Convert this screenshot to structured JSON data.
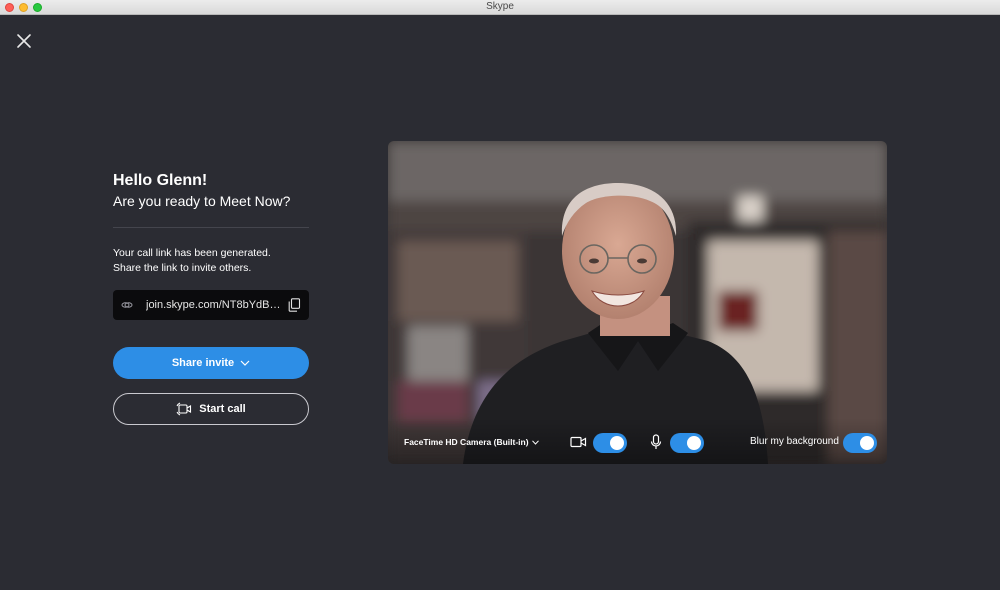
{
  "window": {
    "title": "Skype"
  },
  "greeting": {
    "title": "Hello Glenn!",
    "subtitle": "Are you ready to Meet Now?"
  },
  "link": {
    "info_line1": "Your call link has been generated.",
    "info_line2": "Share the link to invite others.",
    "url": "join.skype.com/NT8bYdBDn..."
  },
  "buttons": {
    "share_invite": "Share invite",
    "start_call": "Start call"
  },
  "preview": {
    "camera_name": "FaceTime HD Camera (Built-in)",
    "video_enabled": true,
    "mic_enabled": true,
    "blur_label": "Blur my background",
    "blur_enabled": true
  },
  "colors": {
    "accent": "#2d8ee6",
    "background": "#2b2c33"
  },
  "icons": [
    "close-icon",
    "link-icon",
    "copy-icon",
    "chevron-down-icon",
    "video-camera-icon",
    "microphone-icon"
  ]
}
